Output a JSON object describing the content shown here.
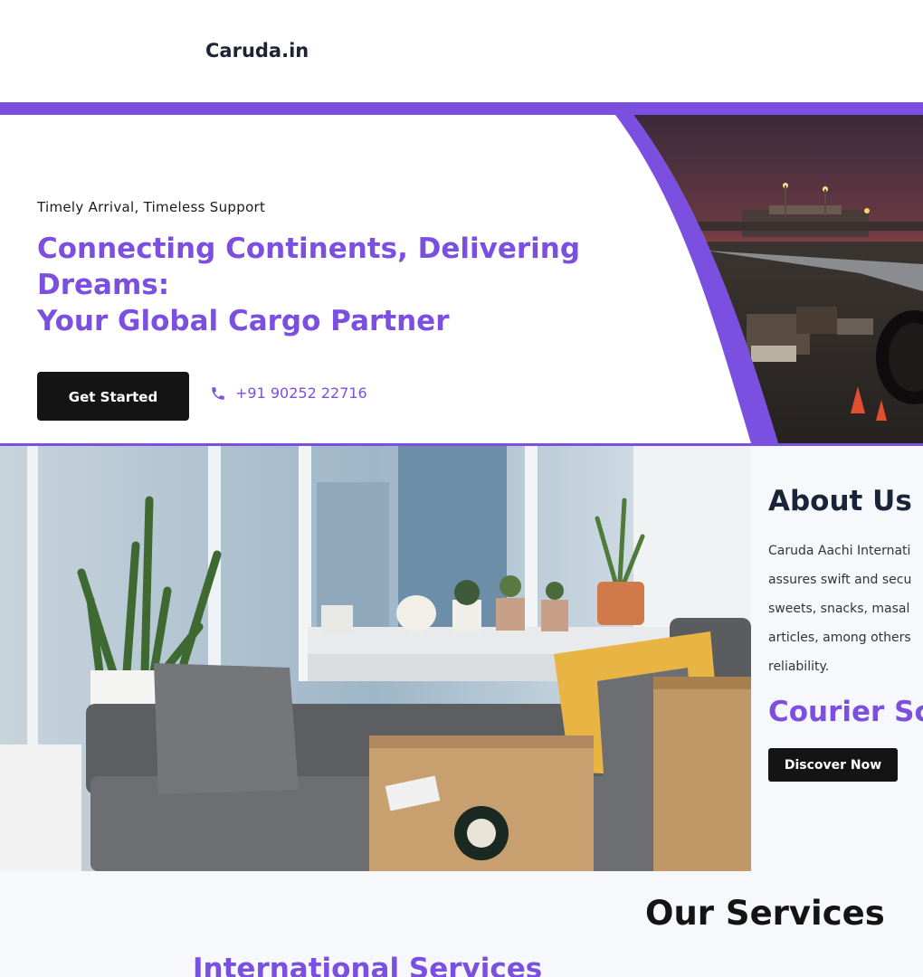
{
  "header": {
    "logo_text": "Caruda.in"
  },
  "hero": {
    "tagline": "Timely Arrival, Timeless Support",
    "headline_lines": [
      "Connecting Continents, Delivering",
      "Dreams:",
      "Your Global Cargo Partner"
    ],
    "cta_label": "Get Started",
    "phone_number": "+91 90252 22716",
    "accent_color": "#7b4fe0"
  },
  "about": {
    "title": "About Us",
    "text_lines": [
      "Caruda Aachi Internati",
      "assures swift and secu",
      "sweets, snacks, masal",
      "articles, among others",
      "reliability."
    ],
    "courier_heading": "Courier Sc",
    "cta_label": "Discover Now"
  },
  "services": {
    "title": "Our Services",
    "first_service": "International Services"
  }
}
